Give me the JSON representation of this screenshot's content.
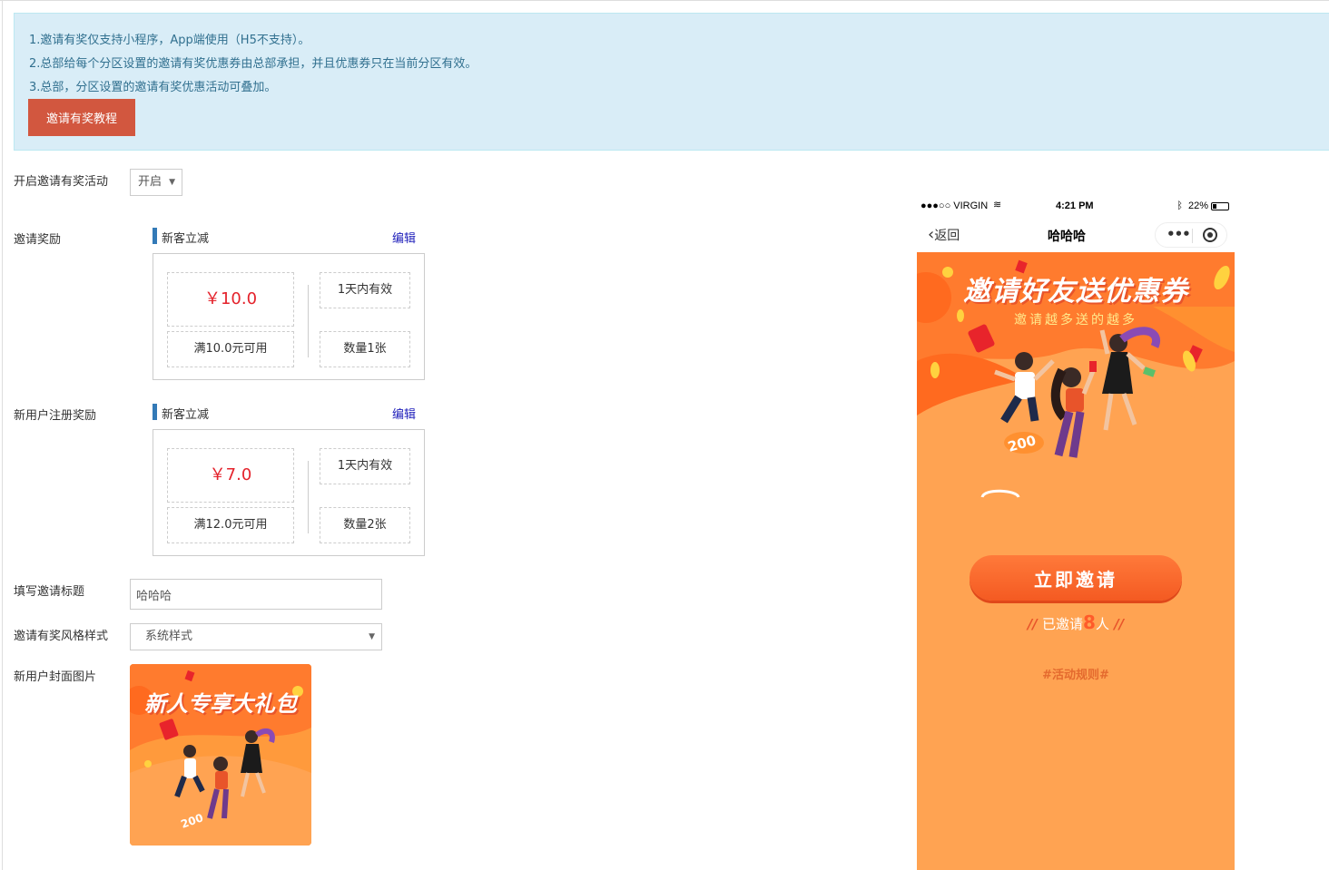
{
  "notice": {
    "line1": "1.邀请有奖仅支持小程序，App端使用（H5不支持）。",
    "line2": "2.总部给每个分区设置的邀请有奖优惠券由总部承担，并且优惠券只在当前分区有效。",
    "line3": "3.总部，分区设置的邀请有奖优惠活动可叠加。",
    "tutorial_button": "邀请有奖教程"
  },
  "form": {
    "enable_label": "开启邀请有奖活动",
    "enable_value": "开启",
    "invite_reward_label": "邀请奖励",
    "register_reward_label": "新用户注册奖励",
    "title_label": "填写邀请标题",
    "title_value": "哈哈哈",
    "style_label": "邀请有奖风格样式",
    "style_value": "系统样式",
    "cover_label": "新用户封面图片"
  },
  "rewards": [
    {
      "type": "新客立减",
      "edit": "编辑",
      "amount": "￥10.0",
      "condition": "满10.0元可用",
      "validity": "1天内有效",
      "quantity": "数量1张"
    },
    {
      "type": "新客立减",
      "edit": "编辑",
      "amount": "￥7.0",
      "condition": "满12.0元可用",
      "validity": "1天内有效",
      "quantity": "数量2张"
    }
  ],
  "cover": {
    "headline": "新人专享大礼包",
    "badge": "200"
  },
  "phone": {
    "carrier": "●●●○○ VIRGIN",
    "time": "4:21 PM",
    "battery": "22%",
    "back": "返回",
    "title": "哈哈哈",
    "poster_headline": "邀请好友送优惠券",
    "poster_sub": "邀请越多送的越多",
    "badge": "200",
    "invite_button": "立即邀请",
    "invited_prefix": "已邀请",
    "invited_count": "8",
    "invited_suffix": "人",
    "rules": "#活动规则#"
  },
  "colors": {
    "notice_bg": "#d9edf7",
    "danger": "#d2573f",
    "price": "#e4222b",
    "poster": "#ffa352",
    "accent_bar": "#337ab7"
  }
}
